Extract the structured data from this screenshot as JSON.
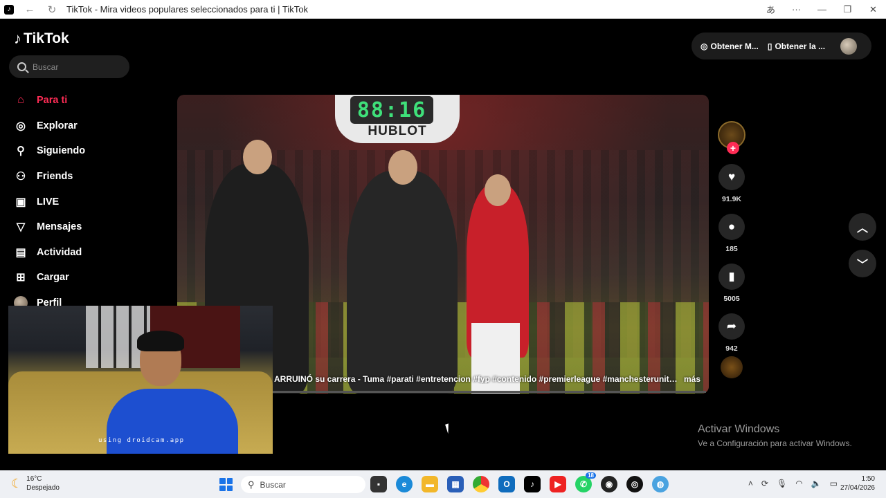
{
  "browser": {
    "tab_title": "TikTok - Mira videos populares seleccionados para ti | TikTok",
    "back_icon": "back-arrow-icon",
    "reload_icon": "reload-icon"
  },
  "brand": {
    "name": "TikTok"
  },
  "search": {
    "placeholder": "Buscar"
  },
  "sidebar": {
    "items": [
      {
        "label": "Para ti",
        "icon": "home-icon",
        "active": true
      },
      {
        "label": "Explorar",
        "icon": "compass-icon"
      },
      {
        "label": "Siguiendo",
        "icon": "user-follow-icon"
      },
      {
        "label": "Friends",
        "icon": "friends-icon"
      },
      {
        "label": "LIVE",
        "icon": "live-tv-icon"
      },
      {
        "label": "Mensajes",
        "icon": "send-icon"
      },
      {
        "label": "Actividad",
        "icon": "activity-icon"
      },
      {
        "label": "Cargar",
        "icon": "upload-icon"
      },
      {
        "label": "Perfil",
        "icon": "profile-avatar"
      }
    ]
  },
  "header": {
    "get_coins": "Obtener M...",
    "get_app": "Obtener la ..."
  },
  "video": {
    "board_brand": "HUBLOT",
    "board_digits": "88:16",
    "caption": "ARRUINÓ su carrera - Tuma #parati #entretencion #fyp #contenido #premierleague #manchesterunited...",
    "more": "más",
    "likes": "91.9K",
    "comments": "185",
    "saves": "5005",
    "shares": "942"
  },
  "webcam": {
    "overlay_text": "using droidcam.app"
  },
  "watermark": {
    "title": "Activar Windows",
    "subtitle": "Ve a Configuración para activar Windows."
  },
  "taskbar": {
    "temperature": "16°C",
    "weather": "Despejado",
    "search": "Buscar",
    "whatsapp_badge": "18",
    "time": "1:50",
    "date": "27/04/2026"
  },
  "colors": {
    "accent": "#fe2c55",
    "background": "#000000"
  }
}
